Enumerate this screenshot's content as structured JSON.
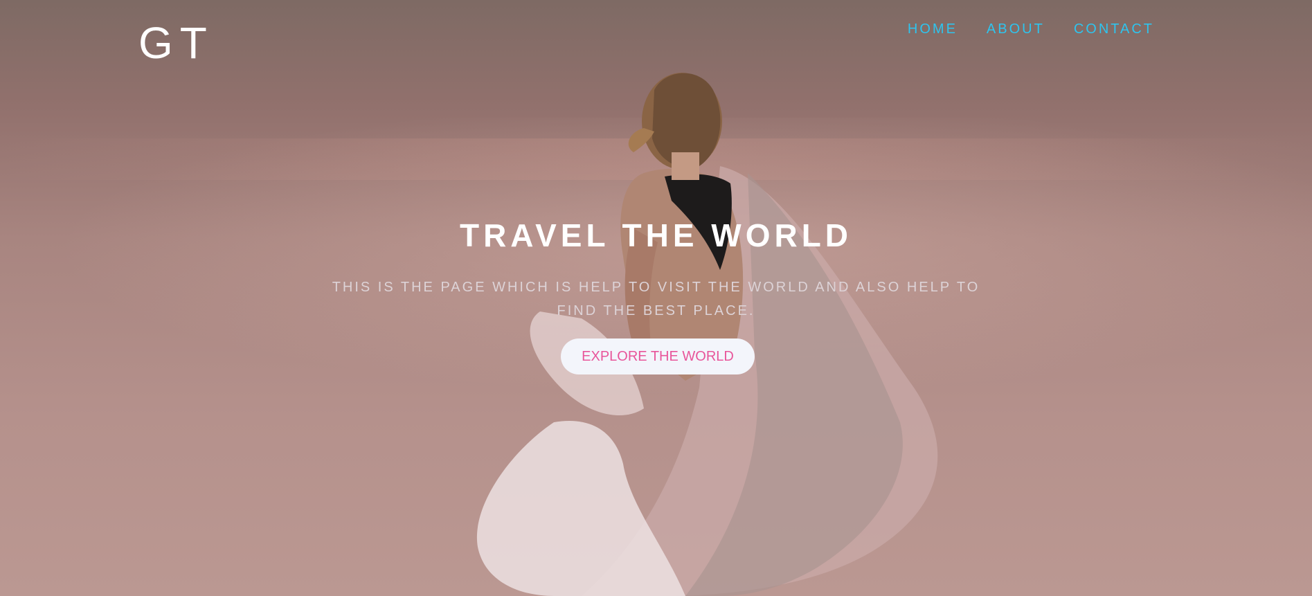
{
  "brand": {
    "logo_text": "GT"
  },
  "nav": {
    "items": [
      {
        "label": "HOME"
      },
      {
        "label": "ABOUT"
      },
      {
        "label": "CONTACT"
      }
    ]
  },
  "hero": {
    "title": "TRAVEL THE WORLD",
    "subtitle": "THIS IS THE PAGE WHICH IS HELP TO VISIT THE WORLD AND ALSO HELP TO FIND THE BEST PLACE.",
    "cta_label": "EXPLORE THE WORLD"
  },
  "colors": {
    "nav_link": "#2ec4ee",
    "cta_text": "#e8559a",
    "cta_bg": "#f3f5fb",
    "title": "#ffffff"
  }
}
